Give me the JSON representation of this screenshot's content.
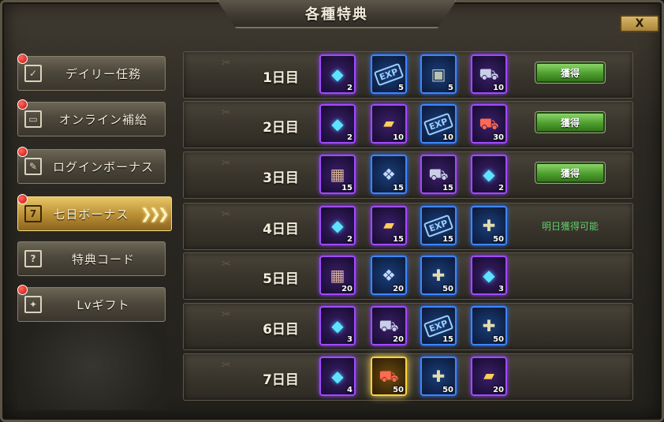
{
  "window": {
    "title": "各種特典",
    "close_label": "X"
  },
  "sidebar": {
    "items": [
      {
        "label": "デイリー任務",
        "icon": "checklist-icon",
        "badge": true,
        "active": false
      },
      {
        "label": "オンライン補給",
        "icon": "monitor-icon",
        "badge": true,
        "active": false
      },
      {
        "label": "ログインボーナス",
        "icon": "notepad-pen-icon",
        "badge": true,
        "active": false
      },
      {
        "label": "七日ボーナス",
        "icon": "calendar-7-icon",
        "badge": true,
        "active": true,
        "icon_text": "7"
      },
      {
        "label": "特典コード",
        "icon": "ticket-icon",
        "badge": false,
        "active": false
      },
      {
        "label": "Lvギフト",
        "icon": "gift-icon",
        "badge": true,
        "active": false
      }
    ]
  },
  "rows": [
    {
      "day": "1日目",
      "action": "button",
      "action_label": "獲得",
      "items": [
        {
          "icon": "diamond-icon",
          "rarity": "purple",
          "qty": "2"
        },
        {
          "icon": "exp-ticket-icon",
          "rarity": "blue",
          "qty": "5"
        },
        {
          "icon": "supply-box-icon",
          "rarity": "blue",
          "qty": "5"
        },
        {
          "icon": "tank-icon",
          "rarity": "purple",
          "qty": "10"
        }
      ]
    },
    {
      "day": "2日目",
      "action": "button",
      "action_label": "獲得",
      "items": [
        {
          "icon": "diamond-icon",
          "rarity": "purple",
          "qty": "2"
        },
        {
          "icon": "gold-card-icon",
          "rarity": "purple",
          "qty": "10"
        },
        {
          "icon": "exp-ticket-icon",
          "rarity": "blue",
          "qty": "10"
        },
        {
          "icon": "red-tank-icon",
          "rarity": "purple",
          "qty": "30"
        }
      ]
    },
    {
      "day": "3日目",
      "action": "button",
      "action_label": "獲得",
      "items": [
        {
          "icon": "ore-crate-icon",
          "rarity": "purple",
          "qty": "15"
        },
        {
          "icon": "crystal-icon",
          "rarity": "blue",
          "qty": "15"
        },
        {
          "icon": "tank-icon",
          "rarity": "purple",
          "qty": "15"
        },
        {
          "icon": "diamond-icon",
          "rarity": "purple",
          "qty": "2"
        }
      ]
    },
    {
      "day": "4日目",
      "action": "text",
      "action_label": "明日獲得可能",
      "items": [
        {
          "icon": "diamond-icon",
          "rarity": "purple",
          "qty": "2"
        },
        {
          "icon": "gold-card-icon",
          "rarity": "purple",
          "qty": "15"
        },
        {
          "icon": "exp-ticket-icon",
          "rarity": "blue",
          "qty": "15"
        },
        {
          "icon": "puzzle-icon",
          "rarity": "blue",
          "qty": "50"
        }
      ]
    },
    {
      "day": "5日目",
      "action": "none",
      "action_label": "",
      "items": [
        {
          "icon": "ore-crate-icon",
          "rarity": "purple",
          "qty": "20"
        },
        {
          "icon": "crystal-icon",
          "rarity": "blue",
          "qty": "20"
        },
        {
          "icon": "puzzle-icon",
          "rarity": "blue",
          "qty": "50"
        },
        {
          "icon": "diamond-icon",
          "rarity": "purple",
          "qty": "3"
        }
      ]
    },
    {
      "day": "6日目",
      "action": "none",
      "action_label": "",
      "items": [
        {
          "icon": "diamond-icon",
          "rarity": "purple",
          "qty": "3"
        },
        {
          "icon": "tank-icon",
          "rarity": "purple",
          "qty": "20"
        },
        {
          "icon": "exp-ticket-icon",
          "rarity": "blue",
          "qty": "15"
        },
        {
          "icon": "puzzle-icon",
          "rarity": "blue",
          "qty": "50"
        }
      ]
    },
    {
      "day": "7日目",
      "action": "none",
      "action_label": "",
      "items": [
        {
          "icon": "diamond-icon",
          "rarity": "purple",
          "qty": "4"
        },
        {
          "icon": "red-tank-icon",
          "rarity": "gold",
          "qty": "50"
        },
        {
          "icon": "puzzle-icon",
          "rarity": "blue",
          "qty": "50"
        },
        {
          "icon": "gold-card-icon",
          "rarity": "purple",
          "qty": "20"
        }
      ]
    }
  ],
  "colors": {
    "accent_gold": "#e7c667",
    "claim_green": "#4e9f2e",
    "status_green": "#5fcf6a",
    "rarity_blue": "#3d86ff",
    "rarity_purple": "#a04bff"
  }
}
